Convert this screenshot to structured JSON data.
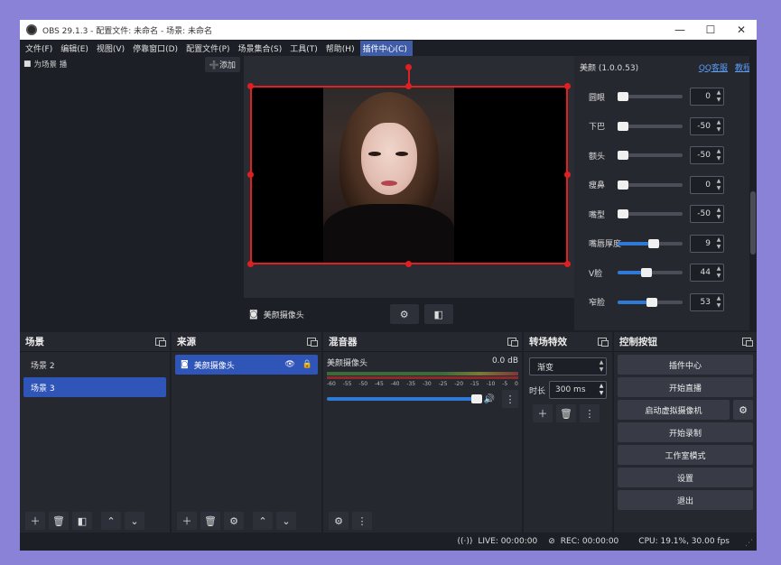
{
  "window": {
    "title": "OBS 29.1.3 - 配置文件: 未命名 - 场景: 未命名",
    "min_icon": "minimize-icon",
    "max_icon": "maximize-icon",
    "close_icon": "close-icon"
  },
  "menu": [
    "文件(F)",
    "编辑(E)",
    "视图(V)",
    "停靠窗口(D)",
    "配置文件(P)",
    "场景集合(S)",
    "工具(T)",
    "帮助(H)",
    "插件中心(C)"
  ],
  "scene_source_bar": {
    "label": "为场景 播",
    "add_label": "➕添加"
  },
  "preview": {
    "source_name": "美颜摄像头"
  },
  "filter_panel": {
    "title": "美颜 (1.0.0.53)",
    "link_qq": "QQ客服",
    "link_tutorial": "教程",
    "rows": [
      {
        "label": "圆眼",
        "value": "0"
      },
      {
        "label": "下巴",
        "value": "-50"
      },
      {
        "label": "额头",
        "value": "-50"
      },
      {
        "label": "瘦鼻",
        "value": "0"
      },
      {
        "label": "嘴型",
        "value": "-50"
      },
      {
        "label": "嘴唇厚度",
        "value": "9"
      },
      {
        "label": "V脸",
        "value": "44"
      },
      {
        "label": "窄脸",
        "value": "53"
      }
    ],
    "slider_fractions": [
      0.05,
      0.05,
      0.05,
      0.05,
      0.05,
      0.55,
      0.44,
      0.53
    ]
  },
  "scenes": {
    "title": "场景",
    "items": [
      {
        "label": "场景 2"
      },
      {
        "label": "场景 3"
      }
    ],
    "selected": "场景 3"
  },
  "sources": {
    "title": "来源",
    "items": [
      {
        "label": "美颜摄像头"
      }
    ]
  },
  "mixer": {
    "title": "混音器",
    "track_name": "美颜摄像头",
    "db": "0.0 dB",
    "ticks": [
      "-60",
      "-55",
      "-50",
      "-45",
      "-40",
      "-35",
      "-30",
      "-25",
      "-20",
      "-15",
      "-10",
      "-5",
      "0"
    ]
  },
  "transitions": {
    "title": "转场特效",
    "selected": "渐变",
    "duration_label": "时长",
    "duration_value": "300 ms"
  },
  "controls": {
    "title": "控制按钮",
    "plugin_center": "插件中心",
    "start_stream": "开始直播",
    "start_vcam": "启动虚拟摄像机",
    "start_record": "开始录制",
    "studio_mode": "工作室模式",
    "settings": "设置",
    "exit": "退出"
  },
  "status": {
    "live": "LIVE: 00:00:00",
    "rec": "REC: 00:00:00",
    "cpu": "CPU: 19.1%, 30.00 fps"
  }
}
